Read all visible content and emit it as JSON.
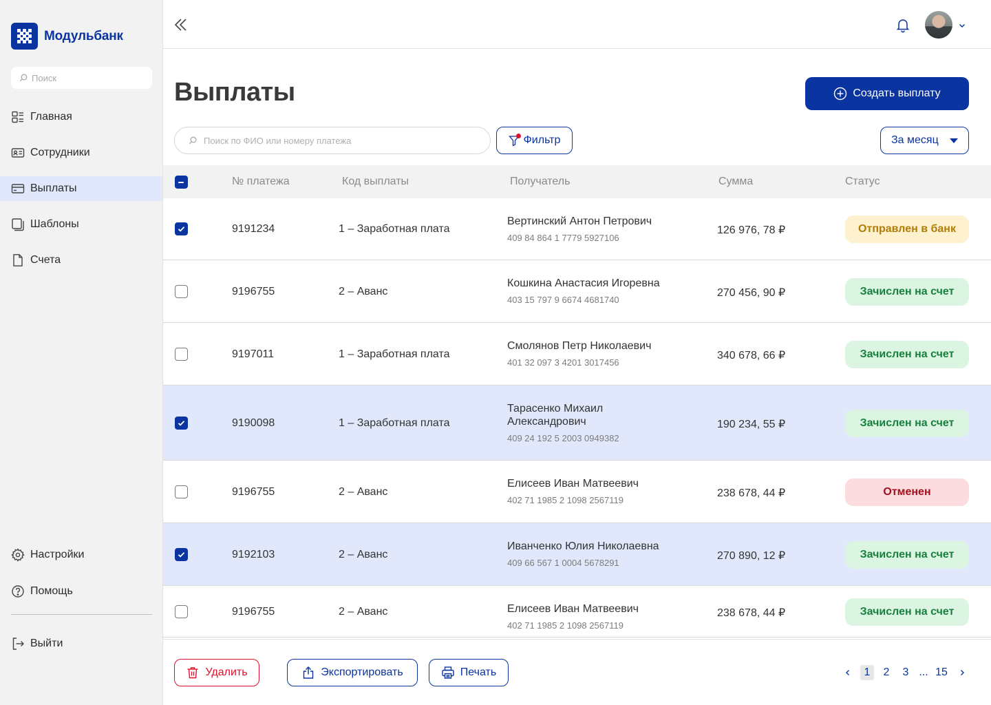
{
  "brand": {
    "name": "Модульбанк",
    "color": "#0a34a0"
  },
  "sidebar": {
    "search_placeholder": "Поиск",
    "items": [
      {
        "label": "Главная",
        "icon": "dashboard-icon",
        "active": false
      },
      {
        "label": "Сотрудники",
        "icon": "id-card-icon",
        "active": false
      },
      {
        "label": "Выплаты",
        "icon": "card-icon",
        "active": true
      },
      {
        "label": "Шаблоны",
        "icon": "templates-icon",
        "active": false
      },
      {
        "label": "Счета",
        "icon": "document-icon",
        "active": false
      }
    ],
    "bottom_items": [
      {
        "label": "Настройки",
        "icon": "gear-icon"
      },
      {
        "label": "Помощь",
        "icon": "help-icon"
      }
    ],
    "logout_label": "Выйти"
  },
  "header": {
    "collapse_icon": "double-chevron-left-icon",
    "bell_icon": "bell-icon"
  },
  "page": {
    "title": "Выплаты",
    "create_button": "Создать выплату",
    "search_placeholder": "Поиск по ФИО или номеру платежа",
    "filter_label": "Фильтр",
    "period_label": "За месяц"
  },
  "table": {
    "columns": [
      "№ платежа",
      "Код выплаты",
      "Получатель",
      "Сумма",
      "Статус"
    ],
    "rows": [
      {
        "checked": true,
        "number": "9191234",
        "code": "1 – Заработная плата",
        "name": "Вертинский Антон Петрович",
        "account": "409 84 864 1 7779 5927106",
        "sum": "126 976, 78 ₽",
        "status": "Отправлен в банк",
        "status_kind": "sent",
        "highlight": false
      },
      {
        "checked": false,
        "number": "9196755",
        "code": "2 – Аванс",
        "name": "Кошкина Анастасия Игоревна",
        "account": "403 15 797 9 6674 4681740",
        "sum": "270 456, 90 ₽",
        "status": "Зачислен на счет",
        "status_kind": "ok",
        "highlight": false
      },
      {
        "checked": false,
        "number": "9197011",
        "code": "1 – Заработная плата",
        "name": "Смолянов Петр Николаевич",
        "account": "401 32 097 3 4201 3017456",
        "sum": "340 678, 66 ₽",
        "status": "Зачислен на счет",
        "status_kind": "ok",
        "highlight": false
      },
      {
        "checked": true,
        "number": "9190098",
        "code": "1 – Заработная плата",
        "name": "Тарасенко Михаил Александрович",
        "account": "409 24 192 5 2003 0949382",
        "sum": "190 234, 55 ₽",
        "status": "Зачислен на счет",
        "status_kind": "ok",
        "highlight": true
      },
      {
        "checked": false,
        "number": "9196755",
        "code": "2 – Аванс",
        "name": "Елисеев Иван Матвеевич",
        "account": "402 71 1985 2 1098 2567119",
        "sum": "238 678, 44 ₽",
        "status": "Отменен",
        "status_kind": "cancel",
        "highlight": false
      },
      {
        "checked": true,
        "number": "9192103",
        "code": "2 – Аванс",
        "name": "Иванченко Юлия Николаевна",
        "account": "409 66 567 1 0004 5678291",
        "sum": "270 890, 12 ₽",
        "status": "Зачислен на счет",
        "status_kind": "ok",
        "highlight": true
      },
      {
        "checked": false,
        "number": "9196755",
        "code": "2 – Аванс",
        "name": "Елисеев Иван Матвеевич",
        "account": "402 71 1985 2 1098 2567119",
        "sum": "238 678, 44 ₽",
        "status": "Зачислен на счет",
        "status_kind": "ok",
        "highlight": false
      }
    ]
  },
  "footer": {
    "delete_label": "Удалить",
    "export_label": "Экспортировать",
    "print_label": "Печать",
    "pages": [
      "1",
      "2",
      "3",
      "...",
      "15"
    ],
    "current_page": "1"
  }
}
